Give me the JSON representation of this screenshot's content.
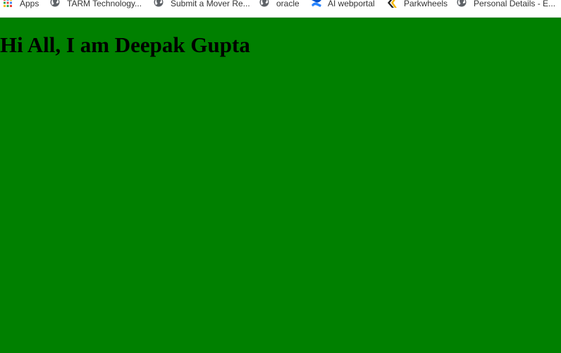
{
  "bookmarks": [
    {
      "label": "Apps",
      "icon": "apps-grid-icon"
    },
    {
      "label": "TARM  Technology...",
      "icon": "globe-icon"
    },
    {
      "label": "Submit a Mover Re...",
      "icon": "globe-icon"
    },
    {
      "label": "oracle",
      "icon": "globe-icon"
    },
    {
      "label": "AI webportal",
      "icon": "confluence-icon"
    },
    {
      "label": "Parkwheels",
      "icon": "parkwheels-icon"
    },
    {
      "label": "Personal Details - E...",
      "icon": "globe-icon"
    }
  ],
  "page": {
    "heading": "Hi All, I am Deepak Gupta",
    "background_color": "#008000"
  }
}
